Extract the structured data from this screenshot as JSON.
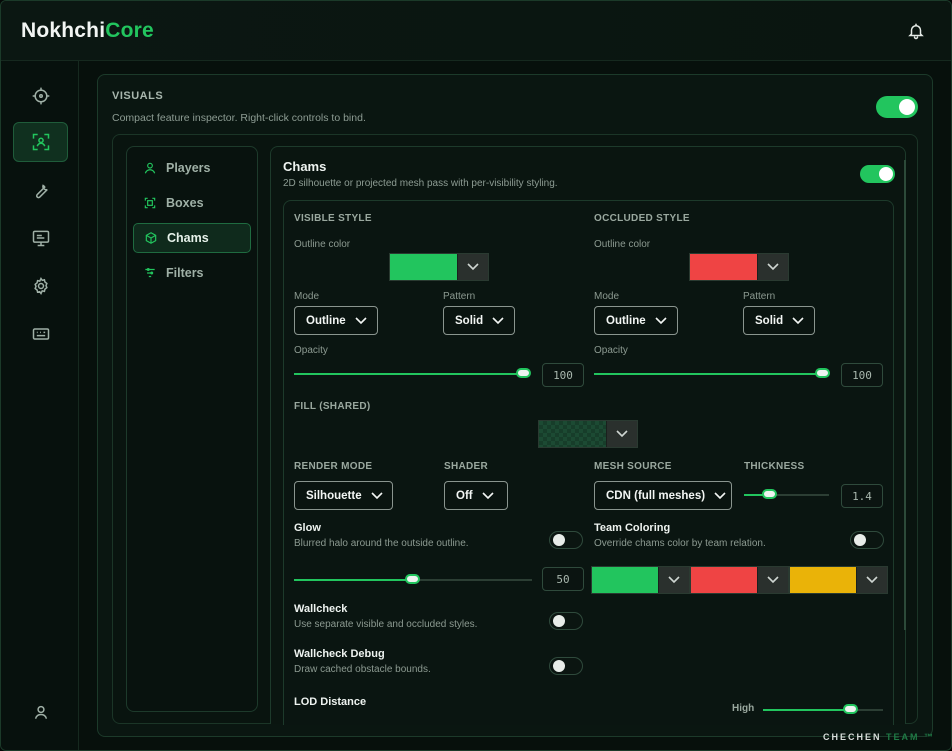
{
  "app": {
    "brand_part1": "Nokhchi",
    "brand_part2": "Core"
  },
  "colors": {
    "accent": "#22c55e",
    "visible": "#22c55e",
    "occluded": "#ef4444",
    "team_enemy": "#eab308"
  },
  "section": {
    "title": "VISUALS",
    "subtitle": "Compact feature inspector. Right-click controls to bind.",
    "enabled": true
  },
  "rail": [
    "crosshair-icon",
    "focus-scan-icon",
    "wrench-icon",
    "monitor-icon",
    "gear-icon",
    "keyboard-icon",
    "user-icon"
  ],
  "subnav": {
    "items": [
      {
        "label": "Players",
        "icon": "person-icon"
      },
      {
        "label": "Boxes",
        "icon": "box-icon"
      },
      {
        "label": "Chams",
        "icon": "cube-icon"
      },
      {
        "label": "Filters",
        "icon": "filter-icon"
      }
    ],
    "active": "Chams"
  },
  "chams": {
    "title": "Chams",
    "subtitle": "2D silhouette or projected mesh pass with per-visibility styling.",
    "enabled": true,
    "visible": {
      "heading": "VISIBLE STYLE",
      "outline_label": "Outline color",
      "mode_label": "Mode",
      "mode": "Outline",
      "pattern_label": "Pattern",
      "pattern": "Solid",
      "opacity_label": "Opacity",
      "opacity": "100"
    },
    "occluded": {
      "heading": "OCCLUDED STYLE",
      "outline_label": "Outline color",
      "mode_label": "Mode",
      "mode": "Outline",
      "pattern_label": "Pattern",
      "pattern": "Solid",
      "opacity_label": "Opacity",
      "opacity": "100"
    },
    "fill_heading": "FILL (SHARED)",
    "render_mode_heading": "RENDER MODE",
    "render_mode": "Silhouette",
    "shader_heading": "SHADER",
    "shader": "Off",
    "mesh_source_heading": "MESH SOURCE",
    "mesh_source": "CDN (full meshes)",
    "thickness_heading": "THICKNESS",
    "thickness": "1.4",
    "thickness_level": 0.25,
    "glow": {
      "title": "Glow",
      "desc": "Blurred halo around the outside outline.",
      "enabled": false,
      "value": "50",
      "level": 0.5
    },
    "team_coloring": {
      "title": "Team Coloring",
      "desc": "Override chams color by team relation.",
      "enabled": false
    },
    "wallcheck": {
      "title": "Wallcheck",
      "desc": "Use separate visible and occluded styles.",
      "enabled": false
    },
    "wallcheck_debug": {
      "title": "Wallcheck Debug",
      "desc": "Draw cached obstacle bounds.",
      "enabled": false
    },
    "lod": {
      "title": "LOD Distance",
      "value_label": "High",
      "level": 0.8
    }
  },
  "watermark": {
    "part1": "CHECHEN",
    "part2": "TEAM ™"
  }
}
